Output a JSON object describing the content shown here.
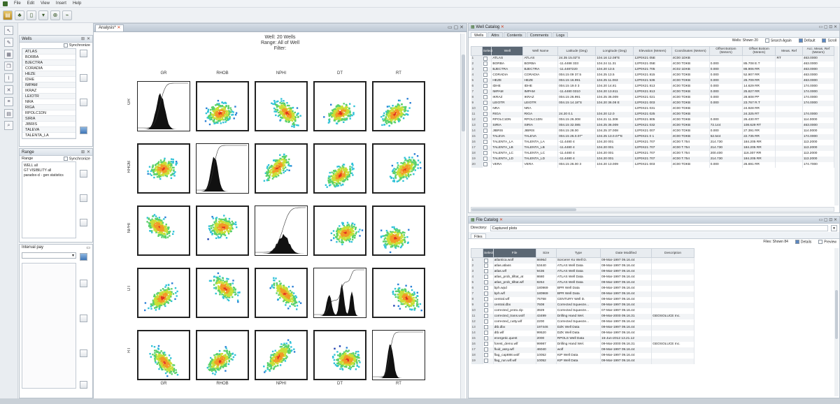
{
  "menu": [
    "File",
    "Edit",
    "View",
    "Insert",
    "Help"
  ],
  "wells_panel": {
    "title": "Wells",
    "sync_label": "Synchronize",
    "items": [
      "ATLAS",
      "BORBA",
      "BJECTRA",
      "CORADIA",
      "HEZE",
      "IDHE",
      "IMPAM",
      "IKRAZ",
      "LEIOTR",
      "NRA",
      "RIGA",
      "RPOLC1DN",
      "SIRIA",
      "JIBRIS",
      "TALEVA",
      "TALENTA_LA"
    ]
  },
  "range_panel": {
    "title": "Range",
    "sync_label": "Synchronize",
    "items": [
      "WELL all",
      "GT VISIBILITY all",
      "paradox-cl - gen statistics"
    ]
  },
  "interval_panel": {
    "title": "Interval pay"
  },
  "plot": {
    "tab_label": "Analysis*",
    "title_lines": [
      "Well: 20 Wells",
      "Range: All of Well",
      "Filter:"
    ],
    "variables": [
      "GR",
      "RHOB",
      "NPHI",
      "DT",
      "RT"
    ]
  },
  "well_catalog": {
    "title": "Well Catalog",
    "tabs": [
      "Wells",
      "Attrs",
      "Contents",
      "Comments",
      "Logs"
    ],
    "top_right": "Wells: Shown 20",
    "checks": [
      "Search Again",
      "Default",
      "Scroll"
    ],
    "columns": [
      "Select",
      "Well",
      "Well Name",
      "Latitude (Deg)",
      "Longitude (Deg)",
      "Elevation (Meters)",
      "Coordinates (Meters)",
      "Offset Bottom (Meters)",
      "Offset Bottom (Meters)",
      "Meas. Ref",
      "Acc. Meas. Ref (Meters)"
    ],
    "rows": [
      [
        "1",
        "ATLAS",
        "ATLAS",
        "24.35 15.02\"S",
        "104.16 12.08\"E",
        "12P0X21 05E",
        "4C00 1DKB",
        "",
        "",
        "RT",
        "463.0000"
      ],
      [
        "2",
        "BORBA",
        "BORBA",
        "-11.4488 333",
        "104.24 11.31",
        "12P0X21 05E",
        "4C00 TDKB",
        "0.000",
        "85.708 E.T",
        "",
        "463.0000"
      ],
      [
        "3",
        "BJECTRA",
        "BJECTRA",
        "-11.4487220",
        "104.20 13.5",
        "12P0X21 705",
        "4C02 1DKB",
        "0.000",
        "86.906 RR",
        "",
        "463.0000"
      ],
      [
        "4",
        "CORADIA",
        "CORADIA",
        "004.15 09 37.5",
        "104.25 13.5",
        "12P0X21 815",
        "4C00 TDKB",
        "0.000",
        "52.907 RR",
        "",
        "463.0000"
      ],
      [
        "5",
        "HEZE",
        "HEZE",
        "004.15 16.991",
        "104.25 11.063",
        "12P0X21 536",
        "4C00 TDKB",
        "0.000",
        "26.709 RR",
        "",
        "463.0000"
      ],
      [
        "6",
        "IDHE",
        "IDHE",
        "004.15 19.0 3",
        "104.20 14.81",
        "12P0X21 813",
        "4C00 TDKB",
        "0.000",
        "14.629 RR",
        "",
        "174.0000"
      ],
      [
        "7",
        "IMPAM",
        "IMPAM",
        "-11.4480 0310",
        "104.20 13.811",
        "12P0X21 813",
        "4C00 TDKB",
        "0.000",
        "25.827 RR",
        "",
        "174.0000"
      ],
      [
        "8",
        "IKRAZ",
        "IKRAZ",
        "004.15 26.991",
        "104.25 36.009",
        "12P0X21 021",
        "4C00 TDKB",
        "0.000",
        "28.608 PP",
        "",
        "174.0000"
      ],
      [
        "9",
        "LEIOTR",
        "LEIOTR",
        "004.15 14.18\"S",
        "104.20 36.08 E",
        "12P0X21 003",
        "4C00 TDKB",
        "0.000",
        "23.767 R.T",
        "",
        "174.0000"
      ],
      [
        "10",
        "NRA",
        "NRA",
        "",
        "",
        "12P0X21 031",
        "4C00 TDKB",
        "",
        "24.928 RR",
        "",
        ""
      ],
      [
        "11",
        "RIGA",
        "RIGA",
        "24.20 0.1",
        "104.20 12.0",
        "12P0X21 025",
        "4C00 TDKB",
        "",
        "24.325 RT",
        "",
        "174.0000"
      ],
      [
        "12",
        "RPOLC1DN",
        "RPOLC1DN",
        "004.15 26.308",
        "104.21 11.308",
        "12P0X21 805",
        "4C00 TDKB",
        "0.000",
        "26.430 RT",
        "",
        "114.0000"
      ],
      [
        "13",
        "SIRIA",
        "SIRIA",
        "004.15 32.085",
        "104.25 36.009",
        "12P0X21 032",
        "4C00 TDKB",
        "72.144",
        "108.629 RT",
        "",
        "463.0000"
      ],
      [
        "14",
        "JIBRIS",
        "JIBRIS",
        "004.15 28.00",
        "104.25 37.008",
        "12P0X21 007",
        "4C00 TDKB",
        "0.000",
        "27.391 RR",
        "",
        "114.0000"
      ],
      [
        "15",
        "TALEVA",
        "TALEVA",
        "004.15 26.0.07\"",
        "104.25 13.0.07\"E",
        "12P0X21 0 1",
        "4C00 TDKB",
        "52.544",
        "22.735 RR",
        "",
        "174.0000"
      ],
      [
        "16",
        "TALENTA_LA",
        "TALENTA_LA",
        "-11.4480 4",
        "104.20 001",
        "12P0X21 707",
        "4C00 T.754",
        "214.730",
        "184.205 RR",
        "",
        "113.2000"
      ],
      [
        "17",
        "TALENTA_LB",
        "TALENTA_LB",
        "-11.4480 4",
        "104.20 001",
        "12P0X21 707",
        "4C00 T.754",
        "214.730",
        "184.205 RR",
        "",
        "113.2000"
      ],
      [
        "18",
        "TALENTA_LC",
        "TALENTA_LC",
        "-11.4480 4",
        "104.20 001",
        "12P0X21 707",
        "4C00 T.754",
        "200.400",
        "116.307 RR",
        "",
        "113.2000"
      ],
      [
        "19",
        "TALENTA_LD",
        "TALENTA_LD",
        "-11.4480 4",
        "104.20 001",
        "12P0X21 707",
        "4C00 T.754",
        "214.730",
        "184.205 RR",
        "",
        "113.2000"
      ],
      [
        "20",
        "VERA",
        "VERA",
        "004.15 26.00 3",
        "104.20 13.009",
        "12P0X21 003",
        "4C00 TDKB",
        "0.000",
        "26.691 RR",
        "",
        "174.7000"
      ]
    ]
  },
  "file_catalog": {
    "title": "File Catalog",
    "directory_label": "Directory:",
    "directory_value": "Captured plots",
    "tab": "Files",
    "top_right": "Files: Shown 84",
    "checks": [
      "Details",
      "Preview"
    ],
    "columns": [
      "Select",
      "File",
      "Size",
      "Type",
      "Date Modified",
      "Description"
    ],
    "rows": [
      [
        "1",
        "atlantica.wolf",
        "8696d",
        "Sorcerer Ko Well D.",
        "09-Mar-1997 09.16.44",
        ""
      ],
      [
        "2",
        "atlas.atlass",
        "53440",
        "ATLAS Well Data",
        "09-Mar-1997 09.16.44",
        ""
      ],
      [
        "3",
        "atlas.wlf",
        "9436",
        "ATLAS Well Data",
        "09-Mar-1997 09.16.44",
        ""
      ],
      [
        "4",
        "atlas_prob_tilltat_at",
        "8680",
        "ATLAS Well Data",
        "09-Mar-1997 09.16.44",
        ""
      ],
      [
        "5",
        "atlas_prob_tilltat.wlf",
        "8264",
        "ATLAS Well Data",
        "09-Mar-1997 09.16.44",
        ""
      ],
      [
        "6",
        "bph.wpd",
        "180969",
        "BPR Well Data",
        "09-Mar-1997 09.16.44",
        ""
      ],
      [
        "7",
        "bph.wlf",
        "180969",
        "BPR Well Data",
        "09-Mar-1997 09.16.44",
        ""
      ],
      [
        "8",
        "central.wlf",
        "76768",
        "CENTURY Well D.",
        "09-Mar-1997 09.16.44",
        ""
      ],
      [
        "9",
        "central.dbx",
        "7608",
        "Corrected Squeeze...",
        "09-Mar-1997 09.16.44",
        ""
      ],
      [
        "10",
        "corrected_proto.zip",
        "3929",
        "Corrected Squeeze...",
        "07-Mar-1997 09.16.44",
        ""
      ],
      [
        "11",
        "corrected_trans.wolf",
        "43499",
        "Drilling Hand Wel.",
        "09-Mar-2000 09.16.31",
        "GEOSOLUCE Inc."
      ],
      [
        "12",
        "corrected_cutty.wlf",
        "2200",
        "Corrected Squeeze...",
        "09-Mar-1997 09.16.44",
        ""
      ],
      [
        "13",
        "dtb.dbx",
        "197446",
        "DZK Well Data",
        "09-Mar-1997 09.16.44",
        ""
      ],
      [
        "14",
        "dtb.wlf",
        "99520",
        "DZK Well Data",
        "09-Mar-1997 09.16.44",
        ""
      ],
      [
        "15",
        "energetic.quest",
        "2000",
        "RPOLS Well Data",
        "15-Jun-2012 13.21.12",
        ""
      ],
      [
        "16",
        "forest_demo.wlf",
        "99987",
        "Drilling Hand Wel.",
        "09-Mar-2000 09.16.31",
        "GEOSOLUCE Inc."
      ],
      [
        "17",
        "fluid_assy.wlf",
        "46040",
        "wolf",
        "09-Mar-1997 09.16.44",
        ""
      ],
      [
        "18",
        "flag_cap888.wolf",
        "10052",
        "KIP Well Data",
        "09-Mar-1997 09.16.44",
        ""
      ],
      [
        "19",
        "flag_run.wlf.wlf",
        "10052",
        "KIP Well Data",
        "09-Mar-1997 09.16.44",
        ""
      ]
    ]
  }
}
